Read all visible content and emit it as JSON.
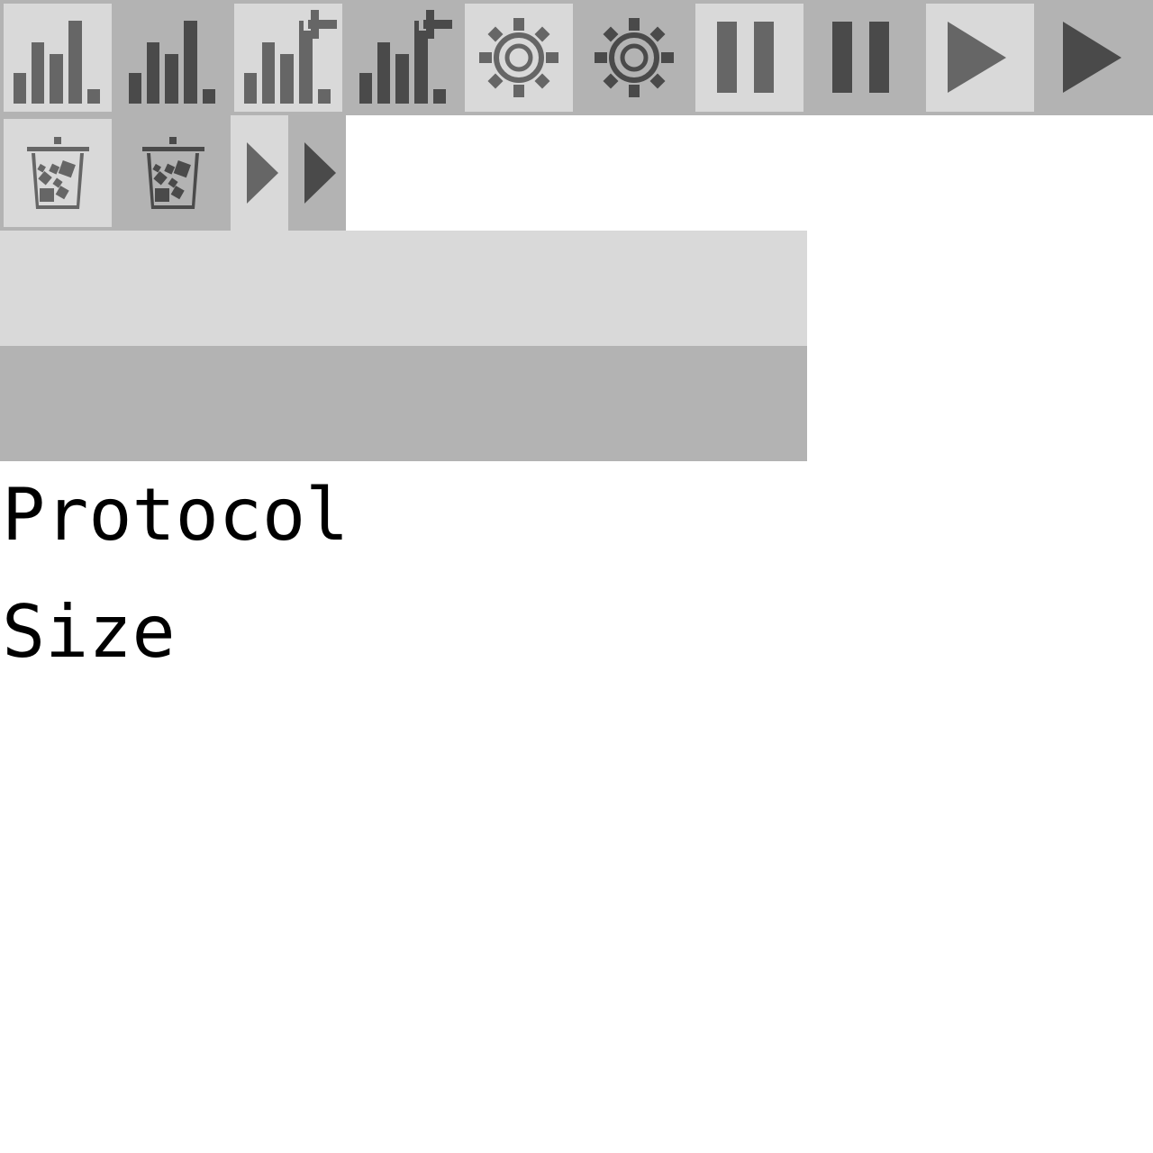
{
  "colors": {
    "tile_bg": "#b3b3b3",
    "tile_light": "#d9d9d9",
    "icon_light": "#666666",
    "icon_dark": "#4a4a4a"
  },
  "icons": [
    {
      "name": "bar-chart-icon",
      "state": "light"
    },
    {
      "name": "bar-chart-icon",
      "state": "dark"
    },
    {
      "name": "bar-chart-add-icon",
      "state": "light"
    },
    {
      "name": "bar-chart-add-icon",
      "state": "dark"
    },
    {
      "name": "gear-icon",
      "state": "light"
    },
    {
      "name": "gear-icon",
      "state": "dark"
    },
    {
      "name": "pause-icon",
      "state": "light"
    },
    {
      "name": "pause-icon",
      "state": "dark"
    },
    {
      "name": "play-icon",
      "state": "light"
    },
    {
      "name": "play-icon",
      "state": "dark"
    },
    {
      "name": "trash-icon",
      "state": "light"
    },
    {
      "name": "trash-icon",
      "state": "dark"
    },
    {
      "name": "expand-arrow-icon",
      "state": "light"
    },
    {
      "name": "expand-arrow-icon",
      "state": "dark"
    }
  ],
  "labels": {
    "protocol": "Protocol",
    "size": "Size"
  }
}
